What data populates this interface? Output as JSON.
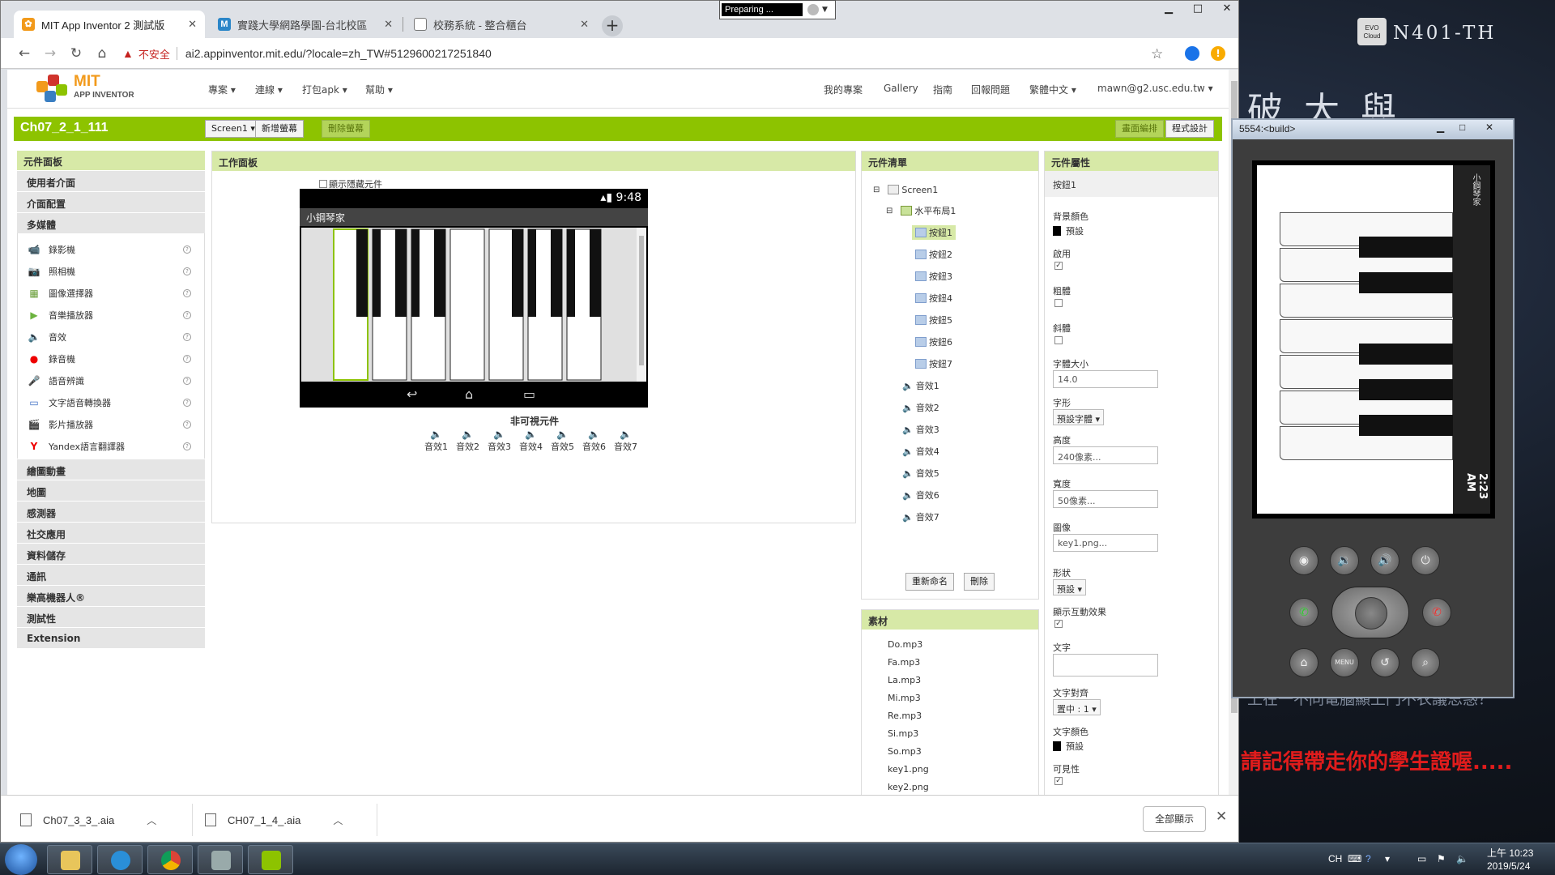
{
  "desktop": {
    "logo_text": "EVO Cloud",
    "host_name": "N401-TH",
    "wall_top": "破 大 與",
    "wall_mid": "上在一不同電腦顯上門不衣議思惑？",
    "wall_warning": "請記得帶走你的學生證喔.....",
    "recorder_label": "Preparing ..."
  },
  "browser": {
    "tabs": [
      {
        "title": "MIT App Inventor 2 測試版",
        "favicon": "ai"
      },
      {
        "title": "實踐大學網路學園-台北校區",
        "favicon": "M"
      },
      {
        "title": "校務系統 - 整合櫃台",
        "favicon": "doc"
      }
    ],
    "insecure_label": "不安全",
    "url": "ai2.appinventor.mit.edu/?locale=zh_TW#5129600217251840"
  },
  "ai": {
    "logo_mit": "MIT",
    "logo_sub": "APP INVENTOR",
    "menus": [
      "專案",
      "連線",
      "打包apk",
      "幫助"
    ],
    "right_menus": [
      "我的專案",
      "Gallery",
      "指南",
      "回報問題",
      "繁體中文",
      "mawn@g2.usc.edu.tw"
    ],
    "project_name": "Ch07_2_1_111",
    "screen_select": "Screen1",
    "add_screen": "新增螢幕",
    "remove_screen": "刪除螢幕",
    "designer": "畫面編排",
    "blocks": "程式設計"
  },
  "palette": {
    "title": "元件面板",
    "categories_top": [
      "使用者介面",
      "介面配置",
      "多媒體"
    ],
    "media_items": [
      {
        "label": "錄影機",
        "icon": "camcorder-icon"
      },
      {
        "label": "照相機",
        "icon": "camera-icon"
      },
      {
        "label": "圖像選擇器",
        "icon": "image-picker-icon"
      },
      {
        "label": "音樂播放器",
        "icon": "player-icon"
      },
      {
        "label": "音效",
        "icon": "sound-icon"
      },
      {
        "label": "錄音機",
        "icon": "recorder-icon"
      },
      {
        "label": "語音辨識",
        "icon": "speech-recognizer-icon"
      },
      {
        "label": "文字語音轉換器",
        "icon": "text-to-speech-icon"
      },
      {
        "label": "影片播放器",
        "icon": "video-player-icon"
      },
      {
        "label": "Yandex語言翻譯器",
        "icon": "yandex-icon"
      }
    ],
    "categories_bottom": [
      "繪圖動畫",
      "地圖",
      "感測器",
      "社交應用",
      "資料儲存",
      "通訊",
      "樂高機器人®",
      "測試性",
      "Extension"
    ]
  },
  "viewer": {
    "title": "工作面板",
    "show_hidden": "顯示隱藏元件",
    "phone_time": "9:48",
    "app_title": "小鋼琴家",
    "nonvisible_title": "非可視元件",
    "nonvisible": [
      "音效1",
      "音效2",
      "音效3",
      "音效4",
      "音效5",
      "音效6",
      "音效7"
    ]
  },
  "tree": {
    "title": "元件清單",
    "screen": "Screen1",
    "arrangement": "水平布局1",
    "buttons": [
      "按鈕1",
      "按鈕2",
      "按鈕3",
      "按鈕4",
      "按鈕5",
      "按鈕6",
      "按鈕7"
    ],
    "sounds": [
      "音效1",
      "音效2",
      "音效3",
      "音效4",
      "音效5",
      "音效6",
      "音效7"
    ],
    "rename": "重新命名",
    "delete": "刪除"
  },
  "media": {
    "title": "素材",
    "files": [
      "Do.mp3",
      "Fa.mp3",
      "La.mp3",
      "Mi.mp3",
      "Re.mp3",
      "Si.mp3",
      "So.mp3",
      "key1.png",
      "key2.png"
    ]
  },
  "props": {
    "title": "元件屬性",
    "component": "按鈕1",
    "bg_label": "背景顏色",
    "bg_value": "預設",
    "enabled_label": "啟用",
    "bold_label": "粗體",
    "italic_label": "斜體",
    "fontsize_label": "字體大小",
    "fontsize_value": "14.0",
    "font_label": "字形",
    "font_value": "預設字體",
    "height_label": "高度",
    "height_value": "240像素...",
    "width_label": "寬度",
    "width_value": "50像素...",
    "image_label": "圖像",
    "image_value": "key1.png...",
    "shape_label": "形狀",
    "shape_value": "預設",
    "feedback_label": "顯示互動效果",
    "text_label": "文字",
    "text_value": "",
    "align_label": "文字對齊",
    "align_value": "置中 : 1",
    "color_label": "文字顏色",
    "color_value": "預設",
    "visible_label": "可見性"
  },
  "downloads": {
    "files": [
      "Ch07_3_3_.aia",
      "CH07_1_4_.aia"
    ],
    "show_all": "全部顯示"
  },
  "emulator": {
    "title": "5554:<build>",
    "app_title": "小鋼琴家",
    "clock": "2:23 AM"
  },
  "taskbar": {
    "lang": "CH",
    "time": "上午 10:23",
    "date": "2019/5/24"
  },
  "colors": {
    "ai_green": "#8dc300",
    "panel_head": "#d7e9a7",
    "insecure_red": "#c5221f",
    "warning_red": "#e01c1c"
  }
}
